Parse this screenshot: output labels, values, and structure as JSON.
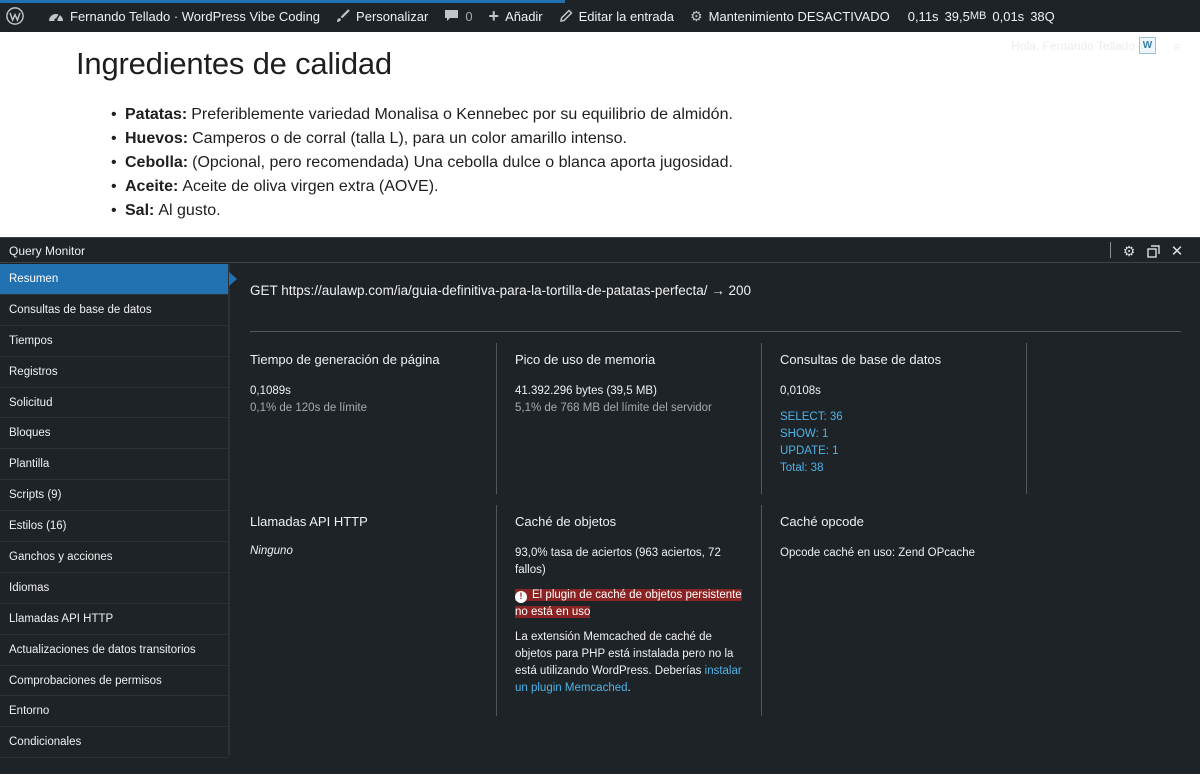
{
  "adminbar": {
    "site_name": "Fernando Tellado · WordPress Vibe Coding",
    "customize": "Personalizar",
    "comments_count": "0",
    "add_new": "Añadir",
    "edit_post": "Editar la entrada",
    "maintenance": "Mantenimiento DESACTIVADO",
    "stats": {
      "time": "0,11s",
      "memory_value": "39,5",
      "memory_unit": "MB",
      "query_time": "0,01s",
      "query_count": "38Q"
    }
  },
  "content": {
    "greeting": "Hola, Fernando Tellado",
    "title": "Ingredientes de calidad",
    "ingredients": [
      {
        "name": "Patatas:",
        "desc": "Preferiblemente variedad Monalisa o Kennebec por su equilibrio de almidón."
      },
      {
        "name": "Huevos:",
        "desc": "Camperos o de corral (talla L), para un color amarillo intenso."
      },
      {
        "name": "Cebolla:",
        "desc": "(Opcional, pero recomendada) Una cebolla dulce o blanca aporta jugosidad."
      },
      {
        "name": "Aceite:",
        "desc": "Aceite de oliva virgen extra (AOVE)."
      },
      {
        "name": "Sal:",
        "desc": "Al gusto."
      }
    ]
  },
  "qm": {
    "title": "Query Monitor",
    "nav": [
      "Resumen",
      "Consultas de base de datos",
      "Tiempos",
      "Registros",
      "Solicitud",
      "Bloques",
      "Plantilla",
      "Scripts (9)",
      "Estilos (16)",
      "Ganchos y acciones",
      "Idiomas",
      "Llamadas API HTTP",
      "Actualizaciones de datos transitorios",
      "Comprobaciones de permisos",
      "Entorno",
      "Condicionales"
    ],
    "request": "GET https://aulawp.com/ia/guia-definitiva-para-la-tortilla-de-patatas-perfecta/ → 200",
    "page_time": {
      "title": "Tiempo de generación de página",
      "value": "0,1089s",
      "sub": "0,1% de 120s de límite"
    },
    "memory": {
      "title": "Pico de uso de memoria",
      "value": "41.392.296 bytes (39,5 MB)",
      "sub": "5,1% de 768 MB del límite del servidor"
    },
    "db": {
      "title": "Consultas de base de datos",
      "value": "0,0108s",
      "select": "SELECT: 36",
      "show": "SHOW: 1",
      "update": "UPDATE: 1",
      "total": "Total: 38"
    },
    "http": {
      "title": "Llamadas API HTTP",
      "value": "Ninguno"
    },
    "object_cache": {
      "title": "Caché de objetos",
      "hit_rate": "93,0% tasa de aciertos (963 aciertos, 72 fallos)",
      "warning": "El plugin de caché de objetos persistente no está en uso",
      "note": "La extensión Memcached de caché de objetos para PHP está instalada pero no la está utilizando WordPress. Deberías",
      "link": "instalar un plugin Memcached",
      "note_end": "."
    },
    "opcode": {
      "title": "Caché opcode",
      "value": "Opcode caché en uso: Zend OPcache"
    }
  }
}
